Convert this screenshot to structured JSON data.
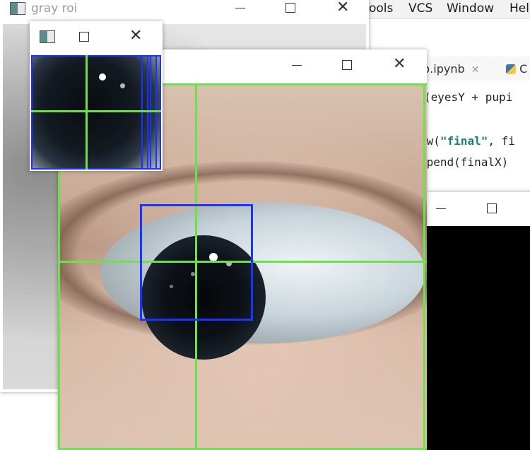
{
  "ide": {
    "menu": [
      "ools",
      "VCS",
      "Window",
      "Hel"
    ],
    "tabs": [
      "p.ipynb",
      "C"
    ],
    "code": {
      "line1": "(eyesY + pupi",
      "line2_pre": "ow(",
      "line2_kw": "\"final\"",
      "line2_post": ", fi",
      "line3": "ppend(finalX)"
    }
  },
  "windows": {
    "gray_roi": {
      "title": "gray roi"
    },
    "small_roi": {
      "title": ""
    },
    "big_eye": {
      "title": ""
    },
    "black": {
      "title": ""
    }
  },
  "controls": {
    "close_glyph": "✕"
  },
  "colors": {
    "overlay_green": "#6ee04a",
    "overlay_blue": "#1a33ff"
  }
}
